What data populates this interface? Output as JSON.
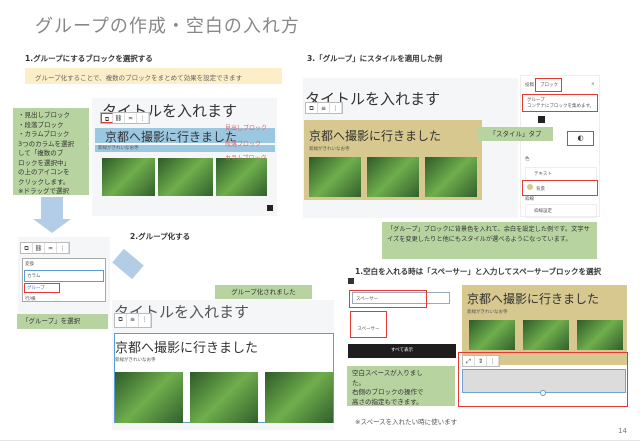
{
  "slide_title": "グループの作成・空白の入れ方",
  "step1": {
    "heading": "1.グループにするブロックを選択する",
    "banner": "グループ化することで、複数のブロックをまとめて効果を設定できます",
    "editor_title": "タイトルを入れます",
    "heading_block": "京都へ撮影に行きました",
    "paragraph": "新緑がきれいなお寺",
    "labels": [
      "見出しブロック",
      "段落ブロック",
      "カラムブロック"
    ],
    "callout": [
      "・見出しブロック",
      "・段落ブロック",
      "・カラムブロック",
      "3つのカラムを選択",
      "して「複数のブ",
      "ロックを選択中」",
      "の上のアイコンを",
      "クリックします。",
      "※ドラッグで選択"
    ]
  },
  "menu": {
    "header": "変換",
    "items": [
      "カラム",
      "グループ",
      "行/横"
    ],
    "callout": "「グループ」を選択"
  },
  "step2": {
    "heading": "2.グループ化する",
    "callout": "グループ化されました",
    "editor_title": "タイトルを入れます",
    "heading_block": "京都へ撮影に行きました",
    "paragraph": "新緑がきれいなお寺"
  },
  "step3": {
    "heading": "3.「グループ」にスタイルを適用した例",
    "editor_title": "タイトルを入れます",
    "heading_block": "京都へ撮影に行きました",
    "paragraph": "新緑がきれいなお寺",
    "sidebar": {
      "tab_post": "投稿",
      "tab_block": "ブロック",
      "block_name": "グループ",
      "block_desc": "コンテナにブロックを集めます。",
      "color_label": "色",
      "text": "テキスト",
      "background": "背景",
      "typography": "枠線",
      "border_item": "枠線設定"
    },
    "style_callout": "「スタイル」タブ",
    "callout": "「グループ」ブロックに背景色を入れて、余白を設定した例です。文字サイズを変更したりと他にもスタイルが選べるようになっています。"
  },
  "step4": {
    "heading": "1.空白を入れる時は「スペーサー」と入力してスペーサーブロックを選択",
    "search_value": "スペーサー",
    "spacer_item": "スペーサー",
    "browse_all": "すべて表示",
    "heading_block": "京都へ撮影に行きました",
    "paragraph": "新緑がきれいなお寺",
    "callout": [
      "空白スペースが入りまし",
      "た。",
      "右側のブロックの操作で",
      "高さの指定もできます。"
    ],
    "note": "※スペースを入れたい時に使います"
  },
  "page_number": "14"
}
